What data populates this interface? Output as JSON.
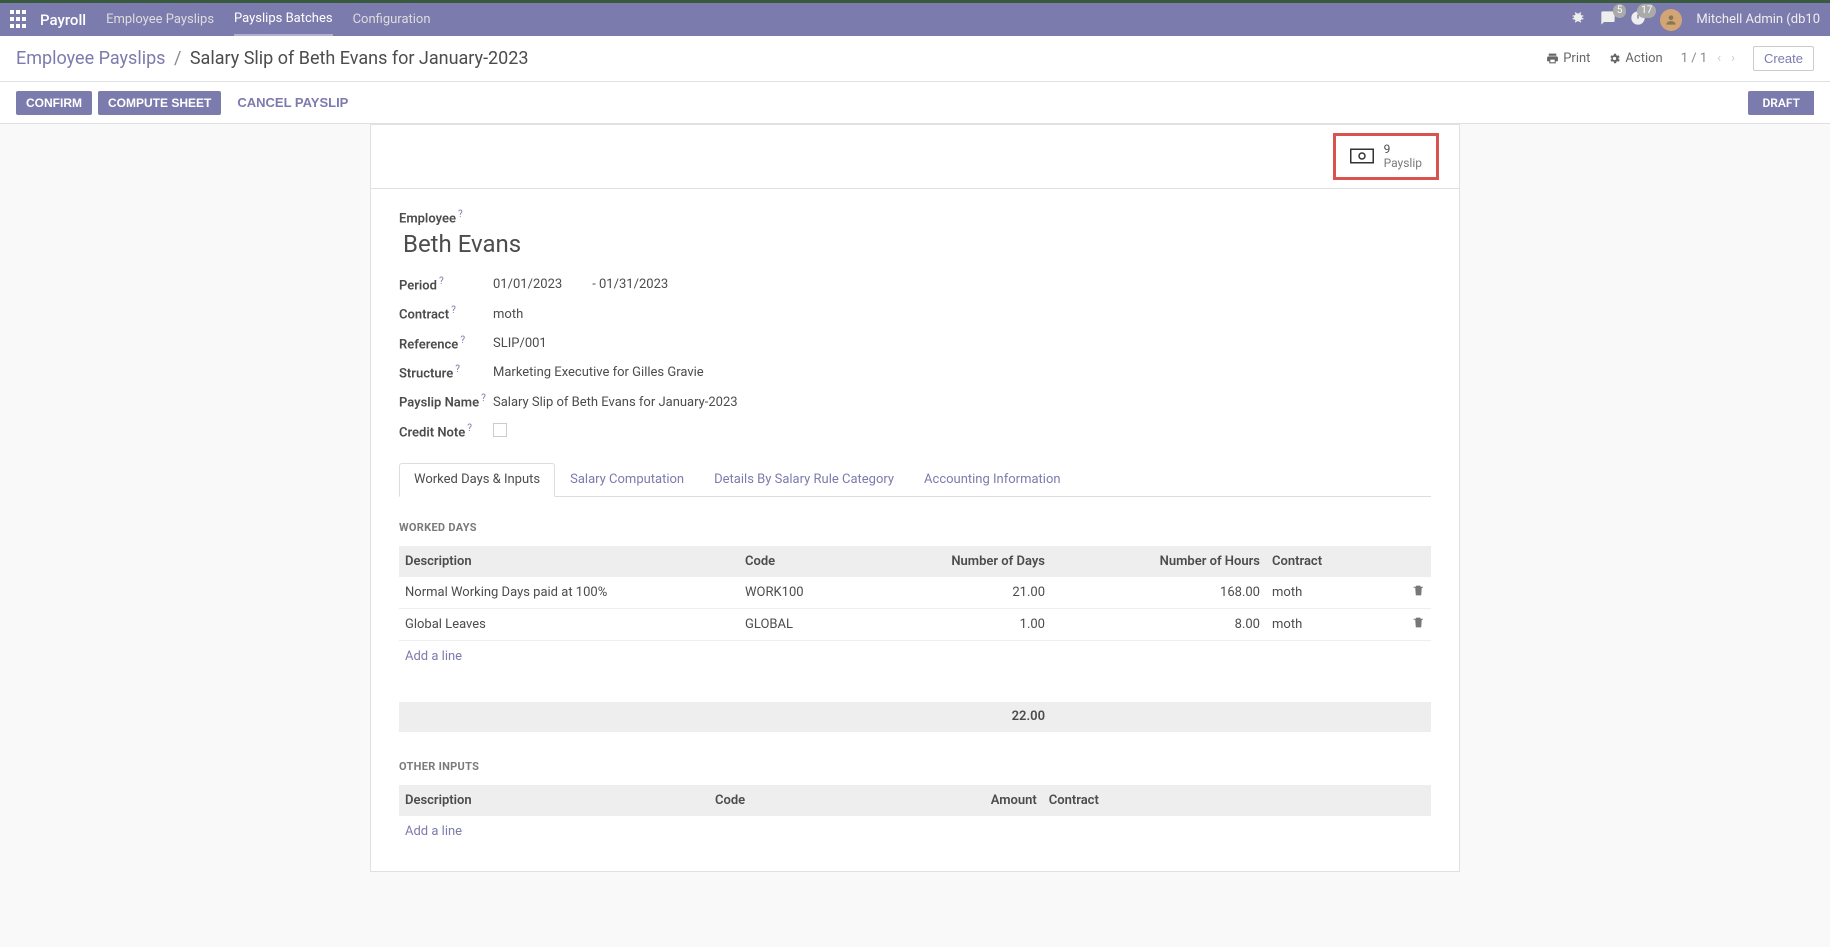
{
  "nav": {
    "app_name": "Payroll",
    "items": [
      "Employee Payslips",
      "Payslips Batches",
      "Configuration"
    ],
    "active_index": 1,
    "msg_count": "5",
    "activity_count": "17",
    "user": "Mitchell Admin (db10"
  },
  "breadcrumb": {
    "parent": "Employee Payslips",
    "current": "Salary Slip of Beth Evans for January-2023"
  },
  "controls": {
    "print": "Print",
    "action": "Action",
    "pager": "1 / 1",
    "create": "Create"
  },
  "actions": {
    "confirm": "CONFIRM",
    "compute": "COMPUTE SHEET",
    "cancel": "CANCEL PAYSLIP",
    "status": "DRAFT"
  },
  "stat": {
    "count": "9",
    "label": "Payslip"
  },
  "form": {
    "employee_label": "Employee",
    "employee_value": "Beth Evans",
    "period_label": "Period",
    "period_from": "01/01/2023",
    "period_to": "-  01/31/2023",
    "contract_label": "Contract",
    "contract_value": "moth",
    "reference_label": "Reference",
    "reference_value": "SLIP/001",
    "structure_label": "Structure",
    "structure_value": "Marketing Executive for Gilles Gravie",
    "payslip_name_label": "Payslip Name",
    "payslip_name_value": "Salary Slip of Beth Evans for January-2023",
    "credit_note_label": "Credit Note"
  },
  "tabs": {
    "items": [
      "Worked Days & Inputs",
      "Salary Computation",
      "Details By Salary Rule Category",
      "Accounting Information"
    ],
    "active_index": 0
  },
  "worked_days": {
    "title": "WORKED DAYS",
    "headers": {
      "desc": "Description",
      "code": "Code",
      "days": "Number of Days",
      "hours": "Number of Hours",
      "contract": "Contract"
    },
    "rows": [
      {
        "desc": "Normal Working Days paid at 100%",
        "code": "WORK100",
        "days": "21.00",
        "hours": "168.00",
        "contract": "moth"
      },
      {
        "desc": "Global Leaves",
        "code": "GLOBAL",
        "days": "1.00",
        "hours": "8.00",
        "contract": "moth"
      }
    ],
    "add": "Add a line",
    "total_days": "22.00"
  },
  "other_inputs": {
    "title": "OTHER INPUTS",
    "headers": {
      "desc": "Description",
      "code": "Code",
      "amount": "Amount",
      "contract": "Contract"
    },
    "add": "Add a line"
  }
}
